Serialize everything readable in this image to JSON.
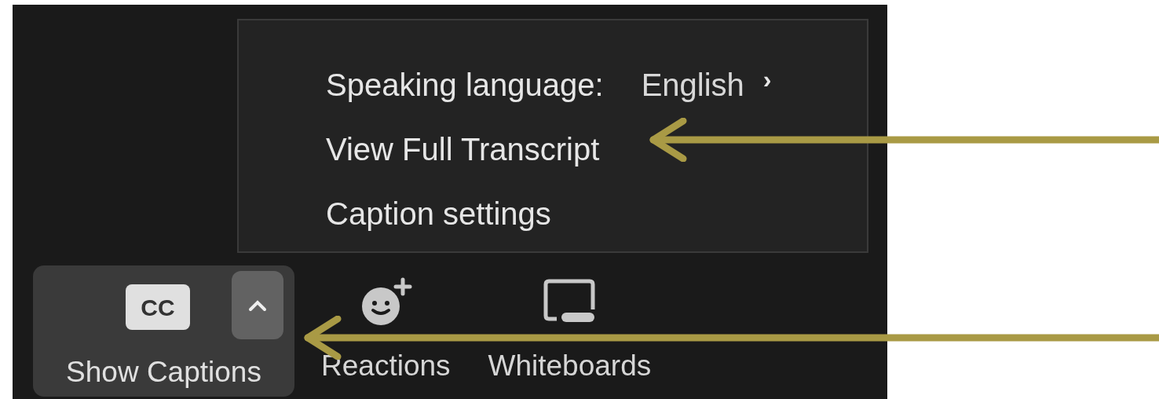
{
  "menu": {
    "items": [
      {
        "kind": "submenu",
        "label": "Speaking language:",
        "value": "English",
        "chevron": "›"
      },
      {
        "kind": "action",
        "label": "View Full Transcript"
      },
      {
        "kind": "action",
        "label": "Caption settings"
      }
    ]
  },
  "toolbar": {
    "buttons": [
      {
        "kind": "captions",
        "label": "Show Captions",
        "badge": "CC",
        "selected": true
      },
      {
        "kind": "reactions",
        "label": "Reactions",
        "selected": false
      },
      {
        "kind": "whiteboards",
        "label": "Whiteboards",
        "selected": false
      }
    ]
  }
}
